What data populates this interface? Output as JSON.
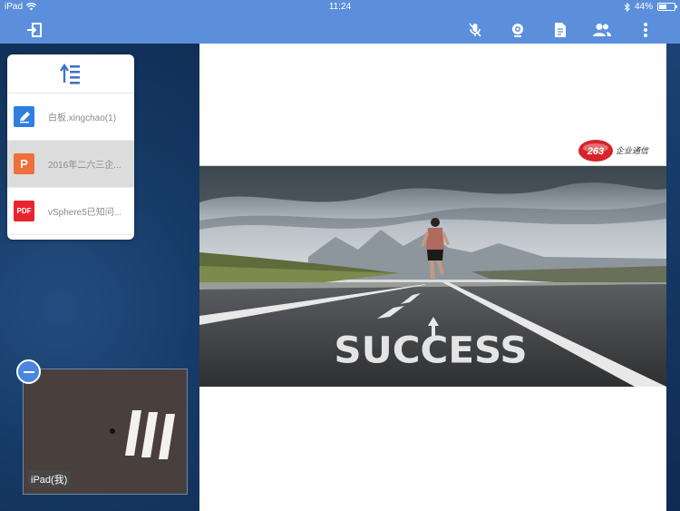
{
  "status_bar": {
    "device": "iPad",
    "time": "11:24",
    "battery": "44%"
  },
  "toolbar": {
    "icons": [
      "exit-icon",
      "mic-off-icon",
      "camera-icon",
      "document-icon",
      "participants-icon",
      "more-icon"
    ]
  },
  "file_list": {
    "header_icon": "sort-upload-icon",
    "items": [
      {
        "type": "whiteboard",
        "icon_label": "",
        "name": "白板.xingchao(1)",
        "color": "#2f7fe0"
      },
      {
        "type": "ppt",
        "icon_label": "P",
        "name": "2016年二六三企...",
        "color": "#f0703c"
      },
      {
        "type": "pdf",
        "icon_label": "PDF",
        "name": "vSphere5已知问...",
        "color": "#e8242e"
      }
    ],
    "selected_index": 1
  },
  "slide": {
    "logo_text": "263",
    "logo_subtext": "企业通信",
    "headline": "SUCCESS"
  },
  "video": {
    "label": "iPad(我)"
  },
  "colors": {
    "toolbar": "#5b8fdc",
    "panel": "#163a66",
    "accent": "#4a86e0"
  }
}
